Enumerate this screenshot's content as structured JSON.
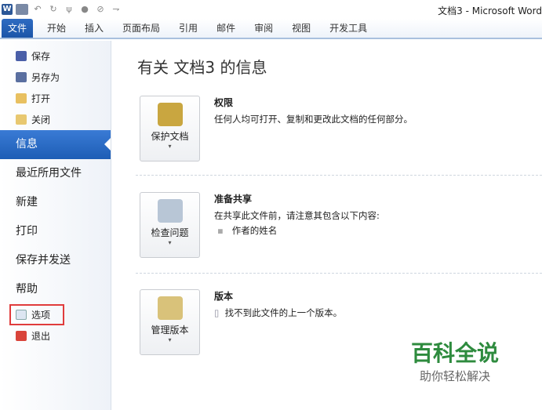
{
  "window": {
    "title": "文档3 - Microsoft Word"
  },
  "ribbon": {
    "tabs": [
      "文件",
      "开始",
      "插入",
      "页面布局",
      "引用",
      "邮件",
      "审阅",
      "视图",
      "开发工具"
    ]
  },
  "sidebar": {
    "small_items": [
      "保存",
      "另存为",
      "打开",
      "关闭"
    ],
    "big_items": [
      "信息",
      "最近所用文件",
      "新建",
      "打印",
      "保存并发送",
      "帮助"
    ],
    "options": "选项",
    "exit": "退出"
  },
  "main": {
    "title": "有关 文档3 的信息",
    "sections": [
      {
        "button": "保护文档",
        "heading": "权限",
        "desc": "任何人均可打开、复制和更改此文档的任何部分。"
      },
      {
        "button": "检查问题",
        "heading": "准备共享",
        "desc": "在共享此文件前，请注意其包含以下内容:",
        "bullet": "作者的姓名"
      },
      {
        "button": "管理版本",
        "heading": "版本",
        "desc": "找不到此文件的上一个版本。"
      }
    ]
  },
  "watermark": {
    "title": "百科全说",
    "subtitle": "助你轻松解决"
  }
}
